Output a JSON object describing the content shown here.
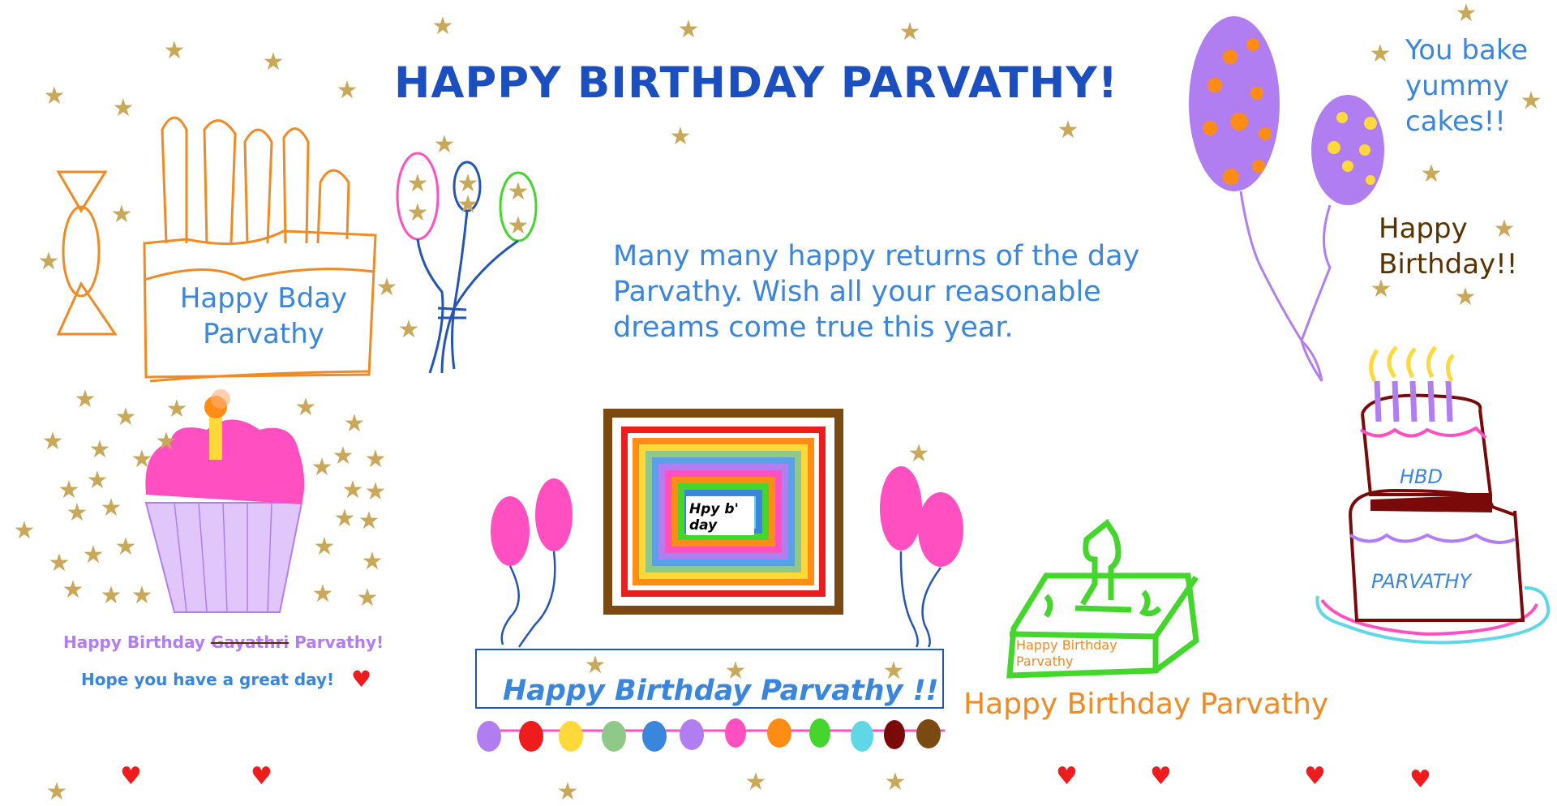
{
  "card": {
    "title": "HAPPY BIRTHDAY PARVATHY!",
    "message": "Many many happy returns of the day Parvathy. Wish all your reasonable dreams come true this year.",
    "top_right_text": "You bake yummy cakes!!",
    "happy_birthday_brown": "Happy Birthday!!",
    "cake_label": "Happy Bday Parvathy",
    "cupcake_line1_prefix": "Happy Birthday",
    "cupcake_line1_struck": "Gayathri",
    "cupcake_line1_suffix": "Parvathy!",
    "cupcake_line2": "Hope you have a great day!",
    "frame_text": "Hpy b' day",
    "banner_text": "Happy Birthday Parvathy !!",
    "green_cake_text": "Happy Birthday Parvathy",
    "orange_line": "Happy Birthday Parvathy",
    "tier_cake_top": "HBD",
    "tier_cake_bottom": "PARVATHY"
  },
  "colors": {
    "title": "#1b4fbf",
    "text_blue": "#3a86dc",
    "star": "#c9a85a",
    "heart": "#ee1c1c",
    "pink": "#ff4fc0",
    "purple": "#b07ef0",
    "orange": "#f08a23",
    "green": "#44d62c",
    "brown": "#7a4a12"
  },
  "icons": [
    "star-icon",
    "heart-icon",
    "balloon-icon",
    "candy-icon",
    "cake-icon",
    "cupcake-icon"
  ]
}
